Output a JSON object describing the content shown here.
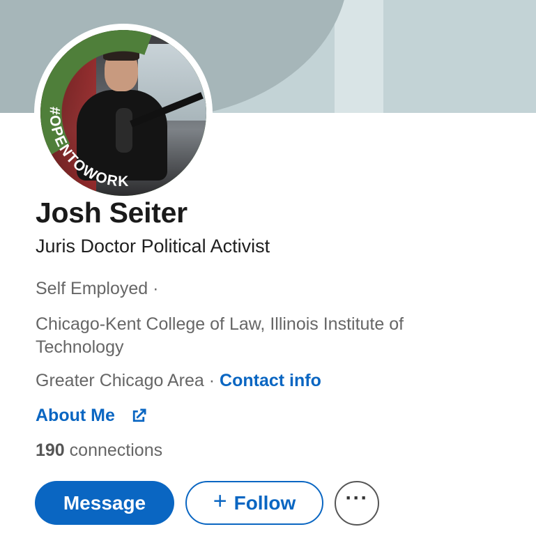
{
  "profile": {
    "name": "Josh Seiter",
    "headline": "Juris Doctor Political Activist",
    "employer": "Self Employed ·",
    "school": "Chicago-Kent College of Law, Illinois Institute of Technology",
    "location": "Greater Chicago Area ·",
    "contact_info_label": "Contact info",
    "about_label": "About Me",
    "connections_count": "190",
    "connections_label": "connections",
    "open_to_work_badge": "#OPENTOWORK"
  },
  "actions": {
    "message_label": "Message",
    "follow_label": "Follow",
    "more_label": "···"
  },
  "colors": {
    "accent": "#0a66c2",
    "open_to_work_green": "#4f7f3a",
    "cover_dark": "#a6b6b9",
    "cover_light": "#c3d3d6"
  },
  "icons": {
    "external_link": "external-link-icon",
    "plus": "plus-icon",
    "more": "more-icon"
  }
}
